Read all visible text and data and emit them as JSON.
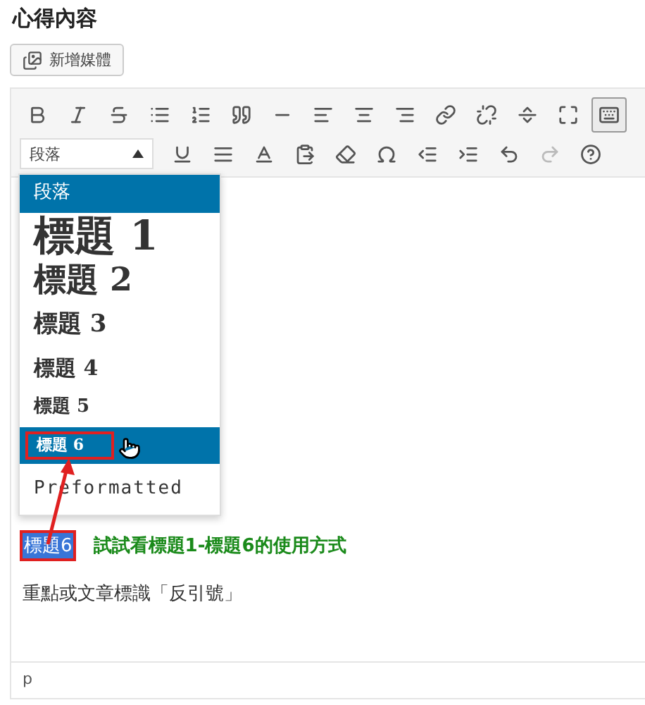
{
  "section_title": "心得內容",
  "add_media_button": {
    "label": "新增媒體"
  },
  "toolbar_rows": [
    [
      {
        "kind": "bold",
        "active": false,
        "disabled": false
      },
      {
        "kind": "italic",
        "active": false,
        "disabled": false
      },
      {
        "kind": "strike",
        "active": false,
        "disabled": false
      },
      {
        "kind": "bullets",
        "active": false,
        "disabled": false
      },
      {
        "kind": "numbers",
        "active": false,
        "disabled": false
      },
      {
        "kind": "quote",
        "active": false,
        "disabled": false
      },
      {
        "kind": "hr",
        "active": false,
        "disabled": false
      },
      {
        "kind": "alignleft",
        "active": false,
        "disabled": false
      },
      {
        "kind": "aligncenter",
        "active": false,
        "disabled": false
      },
      {
        "kind": "alignright",
        "active": false,
        "disabled": false
      },
      {
        "kind": "link",
        "active": false,
        "disabled": false
      },
      {
        "kind": "unlink",
        "active": false,
        "disabled": false
      },
      {
        "kind": "more",
        "active": false,
        "disabled": false
      },
      {
        "kind": "fullscreen",
        "active": false,
        "disabled": false
      },
      {
        "kind": "toggle",
        "active": true,
        "disabled": false
      }
    ],
    [
      {
        "kind": "underline",
        "active": false,
        "disabled": false
      },
      {
        "kind": "justify",
        "active": false,
        "disabled": false
      },
      {
        "kind": "color",
        "active": false,
        "disabled": false
      },
      {
        "kind": "paste",
        "active": false,
        "disabled": false
      },
      {
        "kind": "eraser",
        "active": false,
        "disabled": false
      },
      {
        "kind": "omega",
        "active": false,
        "disabled": false
      },
      {
        "kind": "outdent",
        "active": false,
        "disabled": false
      },
      {
        "kind": "indent",
        "active": false,
        "disabled": false
      },
      {
        "kind": "undo",
        "active": false,
        "disabled": false
      },
      {
        "kind": "redo",
        "active": false,
        "disabled": true
      },
      {
        "kind": "help",
        "active": false,
        "disabled": false
      }
    ]
  ],
  "format_select": {
    "value": "段落"
  },
  "format_menu": [
    {
      "label": "段落",
      "kind": "p",
      "highlighted": true,
      "annotated": false
    },
    {
      "label": "標題 1",
      "kind": "h1",
      "highlighted": false,
      "annotated": false
    },
    {
      "label": "標題 2",
      "kind": "h2",
      "highlighted": false,
      "annotated": false
    },
    {
      "label": "標題 3",
      "kind": "h3",
      "highlighted": false,
      "annotated": false
    },
    {
      "label": "標題 4",
      "kind": "h4",
      "highlighted": false,
      "annotated": false
    },
    {
      "label": "標題 5",
      "kind": "h5",
      "highlighted": false,
      "annotated": false
    },
    {
      "label": "標題 6",
      "kind": "h6",
      "highlighted": true,
      "annotated": true
    },
    {
      "label": "Preformatted",
      "kind": "pre",
      "highlighted": false,
      "annotated": false
    }
  ],
  "content": {
    "selected_text": "標題6",
    "note": "試試看標題1-標題6的使用方式",
    "paragraph": "重點或文章標識「反引號」"
  },
  "status_bar": {
    "path": "p"
  }
}
